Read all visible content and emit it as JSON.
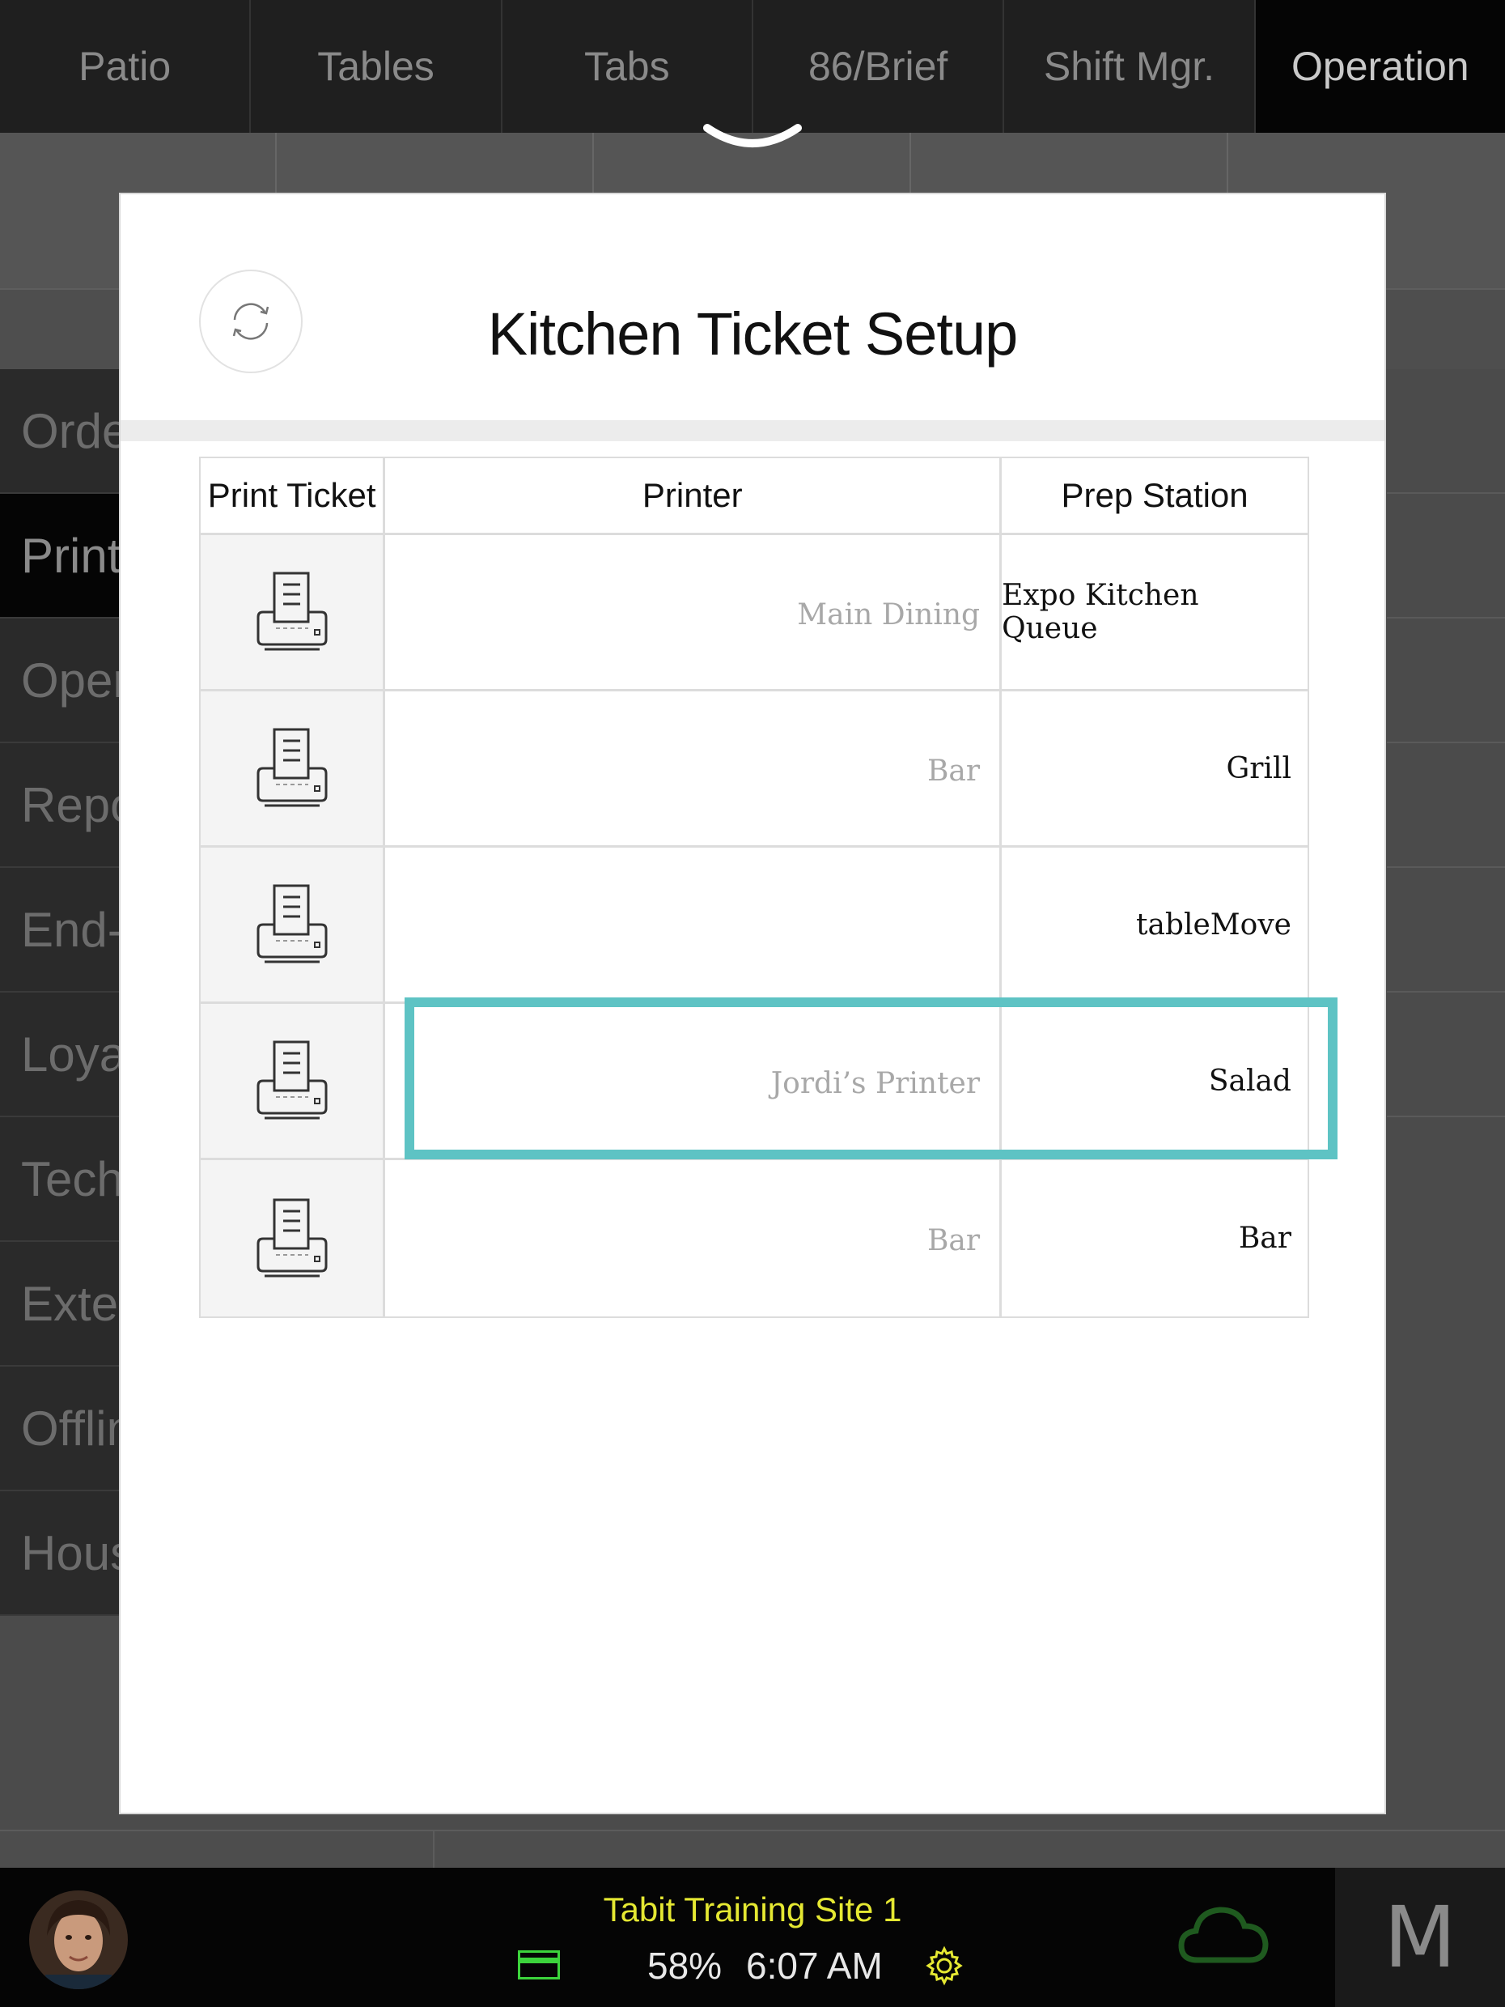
{
  "nav": {
    "tabs": [
      {
        "label": "Patio"
      },
      {
        "label": "Tables"
      },
      {
        "label": "Tabs"
      },
      {
        "label": "86/Brief"
      },
      {
        "label": "Shift Mgr."
      },
      {
        "label": "Operation"
      }
    ]
  },
  "side_menu": {
    "items": [
      {
        "label": "Orde"
      },
      {
        "label": "Print"
      },
      {
        "label": "Oper"
      },
      {
        "label": "Repo"
      },
      {
        "label": "End-"
      },
      {
        "label": "Loya"
      },
      {
        "label": "Tech"
      },
      {
        "label": "Exter"
      },
      {
        "label": "Offlin"
      },
      {
        "label": "Hous"
      }
    ]
  },
  "modal": {
    "title": "Kitchen Ticket Setup",
    "columns": {
      "print_ticket": "Print Ticket",
      "printer": "Printer",
      "prep_station": "Prep Station"
    },
    "rows": [
      {
        "printer": "Main Dining",
        "prep_station": "Expo Kitchen Queue"
      },
      {
        "printer": "Bar",
        "prep_station": "Grill"
      },
      {
        "printer": "",
        "prep_station": "tableMove"
      },
      {
        "printer": "Jordi’s Printer",
        "prep_station": "Salad"
      },
      {
        "printer": "Bar",
        "prep_station": "Bar"
      }
    ]
  },
  "bottom_bar": {
    "site_name": "Tabit Training Site 1",
    "battery": "58%",
    "time": "6:07 AM",
    "user_initial": "M"
  },
  "colors": {
    "highlight": "#5ec3c4",
    "site_name": "#e5e832",
    "card_icon": "#3cd43c",
    "cloud_icon": "#1f5a1f"
  },
  "icons": {
    "refresh": "refresh-icon",
    "printer": "printer-icon",
    "card": "credit-card-icon",
    "settings": "gear-icon",
    "cloud": "cloud-icon",
    "collapse": "chevron-down-icon"
  }
}
